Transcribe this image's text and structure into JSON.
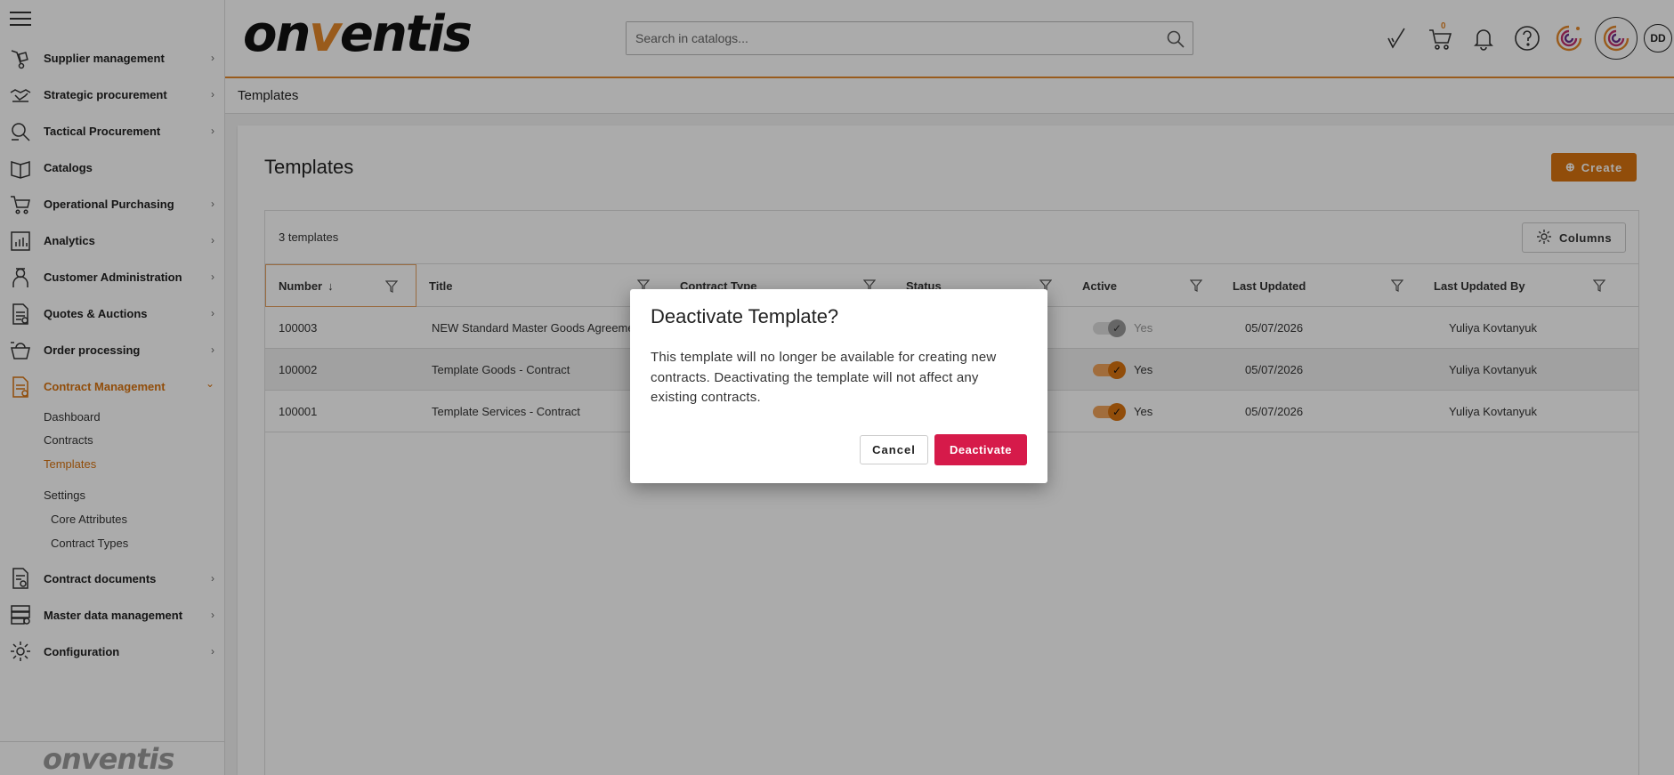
{
  "sidebar": {
    "menu_icon": "hamburger-icon",
    "items": [
      {
        "label": "Supplier management",
        "icon": "hand-truck-icon",
        "chevron": "›"
      },
      {
        "label": "Strategic procurement",
        "icon": "handshake-icon",
        "chevron": "›"
      },
      {
        "label": "Tactical Procurement",
        "icon": "magnifier-icon",
        "chevron": "›"
      },
      {
        "label": "Catalogs",
        "icon": "book-icon",
        "chevron": ""
      },
      {
        "label": "Operational Purchasing",
        "icon": "cart-icon",
        "chevron": "›"
      },
      {
        "label": "Analytics",
        "icon": "bar-chart-icon",
        "chevron": "›"
      },
      {
        "label": "Customer Administration",
        "icon": "person-icon",
        "chevron": "›"
      },
      {
        "label": "Quotes & Auctions",
        "icon": "document-icon",
        "chevron": "›"
      },
      {
        "label": "Order processing",
        "icon": "basket-icon",
        "chevron": "›"
      },
      {
        "label": "Contract Management",
        "icon": "contract-icon",
        "chevron": "⌄"
      }
    ],
    "sub_items": [
      {
        "label": "Dashboard"
      },
      {
        "label": "Contracts"
      },
      {
        "label": "Templates"
      }
    ],
    "settings_label": "Settings",
    "settings_items": [
      {
        "label": "Core Attributes"
      },
      {
        "label": "Contract Types"
      }
    ],
    "bottom_items": [
      {
        "label": "Contract documents",
        "icon": "document-search-icon",
        "chevron": "›"
      },
      {
        "label": "Master data management",
        "icon": "database-icon",
        "chevron": "›"
      },
      {
        "label": "Configuration",
        "icon": "gear-icon",
        "chevron": "›"
      }
    ],
    "footer_logo": "onventis"
  },
  "header": {
    "logo_pre": "on",
    "logo_v": "v",
    "logo_post": "entis",
    "search_placeholder": "Search in catalogs...",
    "cart_count": "0",
    "avatar_initials": "DD",
    "colors": {
      "accent": "#e5882a"
    }
  },
  "breadcrumb": {
    "title": "Templates"
  },
  "main": {
    "title": "Templates",
    "create_icon": "⊕",
    "create_label": "Create",
    "count": "3 templates",
    "columns_label": "Columns",
    "sort_arrow": "↓",
    "headers": [
      "Number",
      "Title",
      "Contract Type",
      "Status",
      "Active",
      "Last Updated",
      "Last Updated By"
    ],
    "rows": [
      {
        "number": "100003",
        "title": "NEW Standard Master Goods Agreement",
        "active": "Yes",
        "updated": "05/07/2026",
        "by": "Yuliya Kovtanyuk"
      },
      {
        "number": "100002",
        "title": "Template Goods - Contract",
        "active": "Yes",
        "updated": "05/07/2026",
        "by": "Yuliya Kovtanyuk"
      },
      {
        "number": "100001",
        "title": "Template Services - Contract",
        "active": "Yes",
        "updated": "05/07/2026",
        "by": "Yuliya Kovtanyuk"
      }
    ]
  },
  "dialog": {
    "title": "Deactivate Template?",
    "body": "This template will no longer be available for creating new contracts. Deactivating the template will not affect any existing contracts.",
    "cancel_label": "Cancel",
    "deactivate_label": "Deactivate",
    "colors": {
      "danger": "#d61a4a"
    }
  }
}
